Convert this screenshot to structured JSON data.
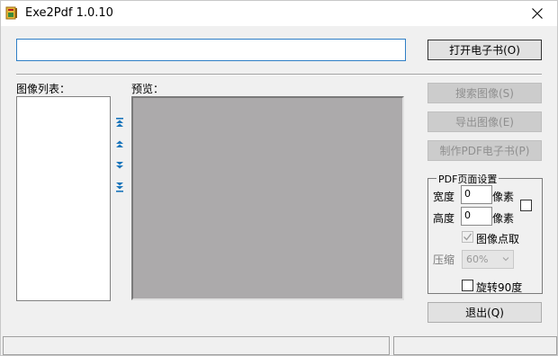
{
  "window": {
    "title": "Exe2Pdf 1.0.10"
  },
  "toolbar": {
    "path_value": "",
    "open_label": "打开电子书(O)"
  },
  "labels": {
    "image_list": "图像列表：",
    "preview": "预览："
  },
  "buttons": {
    "search": "搜索图像(S)",
    "export": "导出图像(E)",
    "make_pdf": "制作PDF电子书(P)",
    "exit": "退出(Q)"
  },
  "pdf_settings": {
    "title": "PDF页面设置",
    "width_label": "宽度",
    "width_value": "0",
    "width_unit": "像素",
    "height_label": "高度",
    "height_value": "0",
    "height_unit": "像素",
    "pixel_pick_label": "图像点取",
    "pixel_pick_checked": true,
    "compress_label": "压缩",
    "compress_value": "60%",
    "rotate_label": "旋转90度",
    "rotate_checked": false
  },
  "colors": {
    "input_border": "#2f7fc6",
    "preview_bg": "#acaaab",
    "arrow_color": "#1a75bb"
  }
}
